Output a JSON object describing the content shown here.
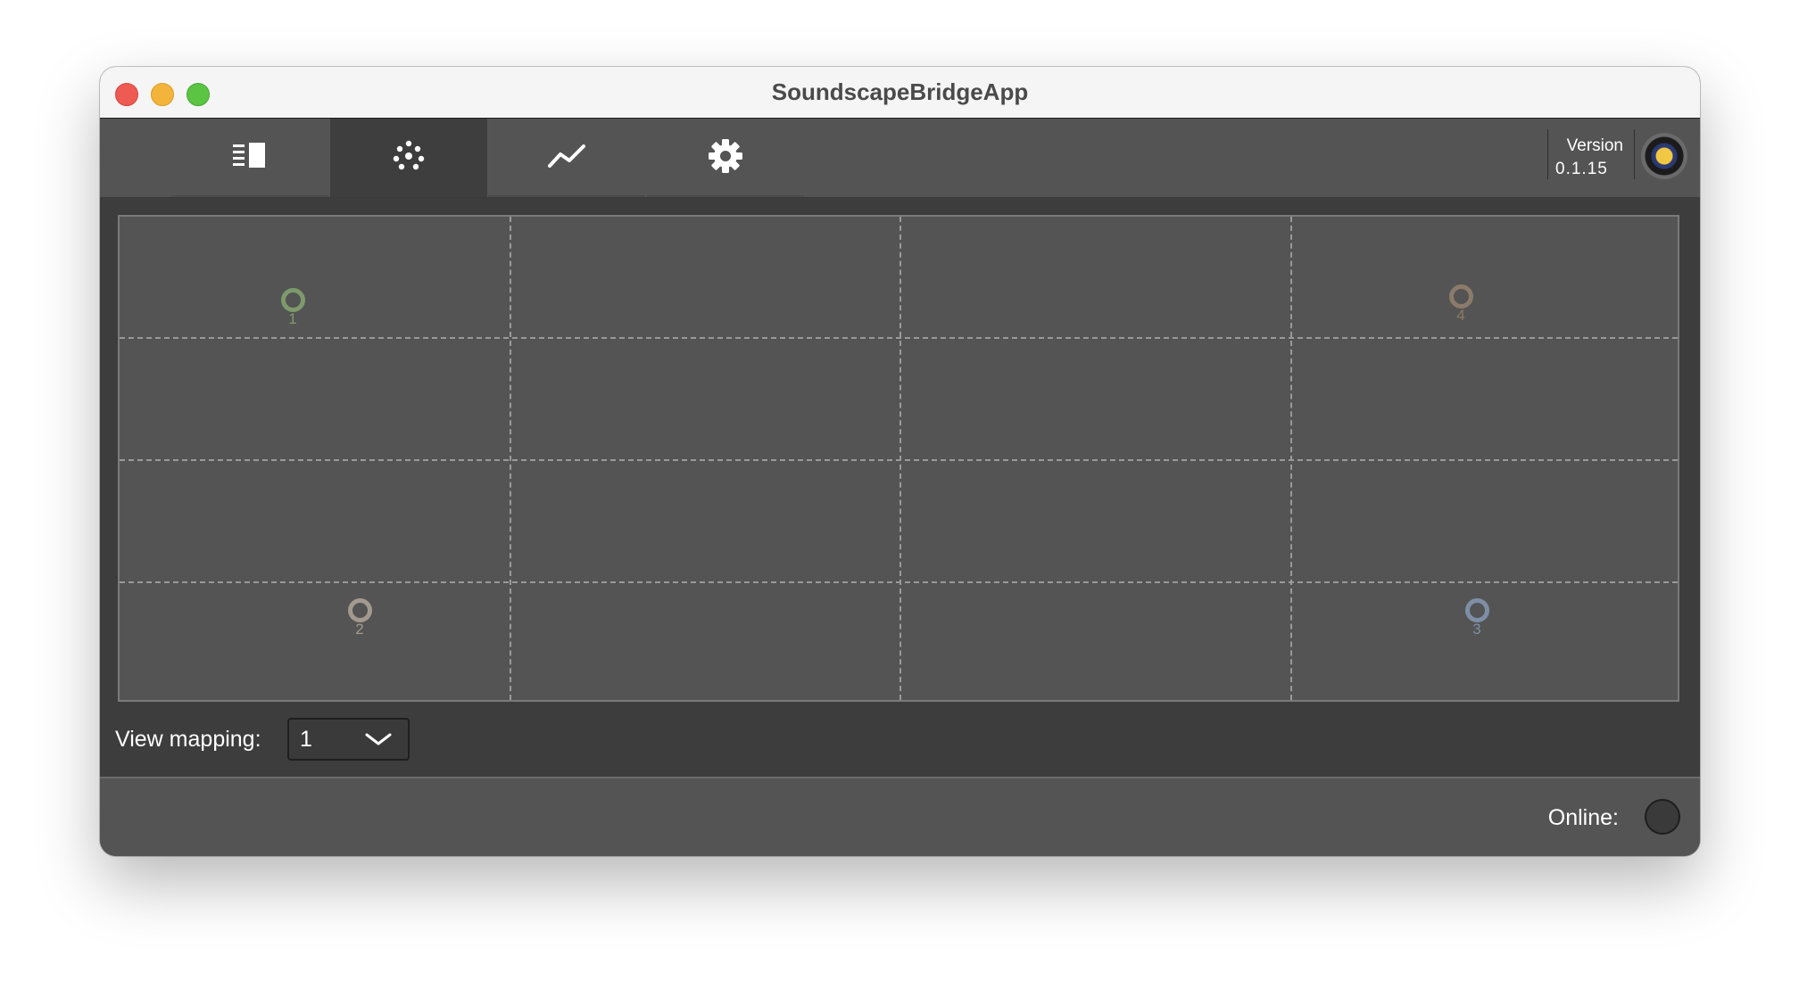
{
  "window": {
    "title": "SoundscapeBridgeApp"
  },
  "toolbar": {
    "tabs": [
      {
        "id": "overview",
        "icon": "list-panel-icon",
        "active": false
      },
      {
        "id": "positions",
        "icon": "dots-scatter-icon",
        "active": true
      },
      {
        "id": "statistics",
        "icon": "line-chart-icon",
        "active": false
      },
      {
        "id": "settings",
        "icon": "gear-icon",
        "active": false
      }
    ],
    "version_label": "Version",
    "version_number": "0.1.15",
    "status_icon": "status-indicator-icon"
  },
  "map": {
    "points": [
      {
        "label": "1",
        "color": "#7e9a6c"
      },
      {
        "label": "2",
        "color": "#a39a8f"
      },
      {
        "label": "3",
        "color": "#7d8fa6"
      },
      {
        "label": "4",
        "color": "#8c7a6a"
      }
    ]
  },
  "mapping": {
    "label": "View mapping:",
    "value": "1"
  },
  "footer": {
    "online_label": "Online:"
  },
  "colors": {
    "background": "#545454",
    "content_background": "#3d3d3d",
    "grid_line": "#9a9a9a"
  }
}
